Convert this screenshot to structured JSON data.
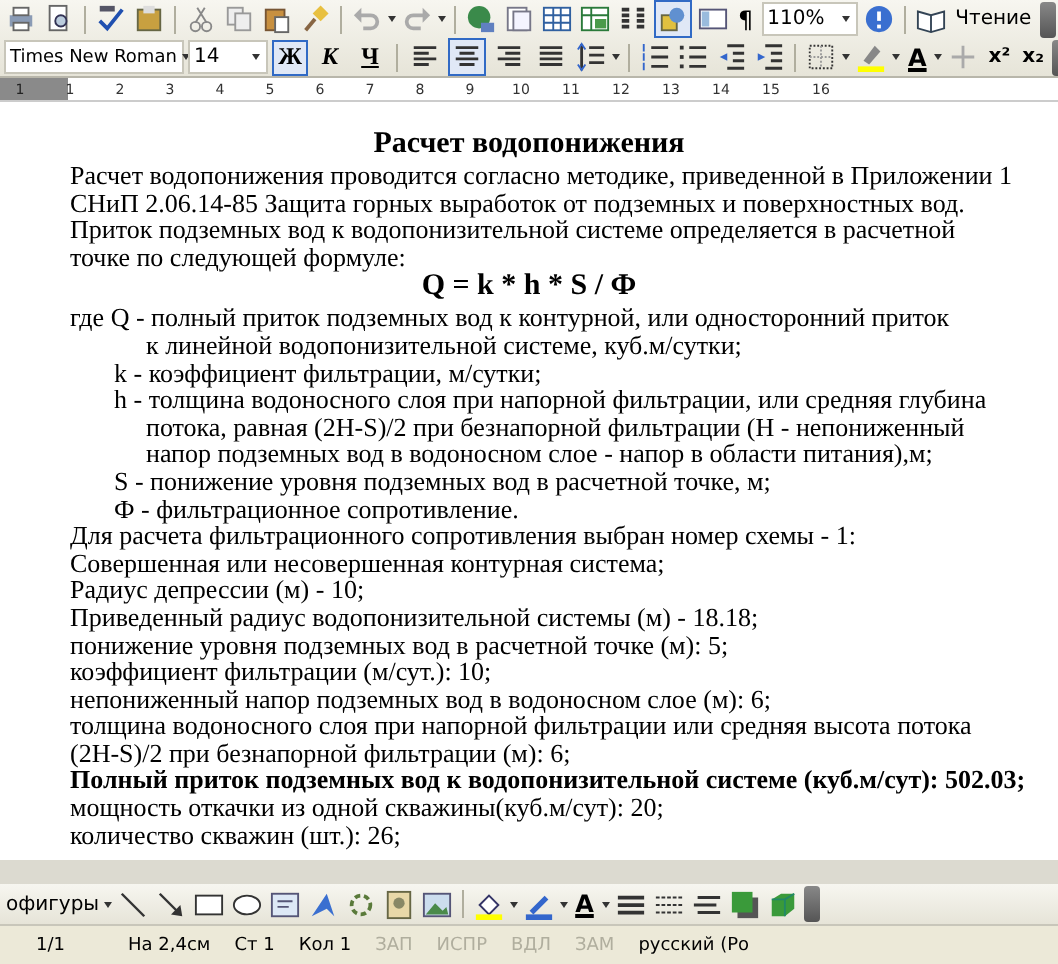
{
  "standard_toolbar": {
    "drawing_button": {
      "selected": true
    },
    "pilcrow": "¶",
    "zoom": "110%",
    "reading_button": "Чтение"
  },
  "formatting_toolbar": {
    "font": "Times New Roman",
    "size": "14",
    "style_buttons": [
      {
        "label": "Ж",
        "selected": true
      },
      {
        "label": "К",
        "selected": false
      },
      {
        "label": "Ч",
        "selected": false
      }
    ],
    "alignment": [
      {
        "selected": false
      },
      {
        "selected": true
      },
      {
        "selected": false
      },
      {
        "selected": false
      }
    ],
    "font_color_letter": "A",
    "superscript": "x²",
    "subscript": "x₂"
  },
  "ruler": {
    "numbers": [
      "1",
      "1",
      "2",
      "3",
      "4",
      "5",
      "6",
      "7",
      "8",
      "9",
      "10",
      "11",
      "12",
      "13",
      "14",
      "15",
      "16"
    ]
  },
  "document": {
    "lines": [
      {
        "kind": "title",
        "text": "Расчет водопонижения"
      },
      {
        "kind": "text",
        "text": "Расчет водопонижения проводится согласно методике, приведенной в Приложении 1"
      },
      {
        "kind": "text",
        "text": "СНиП 2.06.14-85 Защита горных выработок от подземных и поверхностных вод."
      },
      {
        "kind": "text",
        "text": "Приток подземных вод к водопонизительной системе определяется в расчетной"
      },
      {
        "kind": "text",
        "text": "точке по следующей формуле:"
      },
      {
        "kind": "formula",
        "text": "Q = k * h * S / Ф"
      },
      {
        "kind": "text",
        "text": "где Q - полный приток подземных вод к контурной, или односторонний приток"
      },
      {
        "kind": "cont",
        "text": "к линейной водопонизительной системе, куб.м/сутки;"
      },
      {
        "kind": "term",
        "text": "k - коэффициент фильтрации, м/сутки;"
      },
      {
        "kind": "term",
        "text": "h - толщина водоносного слоя при напорной фильтрации, или средняя глубина"
      },
      {
        "kind": "cont",
        "text": "потока, равная (2H-S)/2 при безнапорной фильтрации (H - непониженный"
      },
      {
        "kind": "cont",
        "text": "напор подземных вод в водоносном слое - напор в области питания),м;"
      },
      {
        "kind": "term",
        "text": "S - понижение уровня подземных вод в расчетной точке, м;"
      },
      {
        "kind": "term",
        "text": "Ф - фильтрационное сопротивление."
      },
      {
        "kind": "text",
        "text": "Для расчета фильтрационного сопротивления выбран номер схемы - 1:"
      },
      {
        "kind": "text",
        "text": "Совершенная или несовершенная контурная система;"
      },
      {
        "kind": "text",
        "text": "Радиус депрессии (м) - 10;"
      },
      {
        "kind": "text",
        "text": "Приведенный радиус водопонизительной системы (м) - 18.18;"
      },
      {
        "kind": "text",
        "text": "понижение уровня подземных вод в расчетной точке (м): 5;"
      },
      {
        "kind": "text",
        "text": "коэффициент фильтрации (м/сут.): 10;"
      },
      {
        "kind": "text",
        "text": "непониженный напор подземных вод в водоносном слое (м): 6;"
      },
      {
        "kind": "text",
        "text": "толщина водоносного слоя при напорной фильтрации или средняя высота потока"
      },
      {
        "kind": "text",
        "text": "(2H-S)/2 при безнапорной фильтрации (м): 6;"
      },
      {
        "kind": "bold",
        "text": "Полный приток подземных вод к водопонизительной системе (куб.м/сут): 502.03;"
      },
      {
        "kind": "text",
        "text": "мощность откачки из одной скважины(куб.м/сут): 20;"
      },
      {
        "kind": "text",
        "text": "количество скважин (шт.): 26;"
      }
    ]
  },
  "drawing_toolbar": {
    "shapes_menu": "офигуры",
    "font_color_letter": "A"
  },
  "status_bar": {
    "fields": [
      {
        "text": "1/1",
        "disabled": false
      },
      {
        "text": "На 2,4см",
        "disabled": false
      },
      {
        "text": "Ст 1",
        "disabled": false
      },
      {
        "text": "Кол 1",
        "disabled": false
      },
      {
        "text": "ЗАП",
        "disabled": true
      },
      {
        "text": "ИСПР",
        "disabled": true
      },
      {
        "text": "ВДЛ",
        "disabled": true
      },
      {
        "text": "ЗАМ",
        "disabled": true
      },
      {
        "text": "русский (Ро",
        "disabled": false
      }
    ]
  }
}
